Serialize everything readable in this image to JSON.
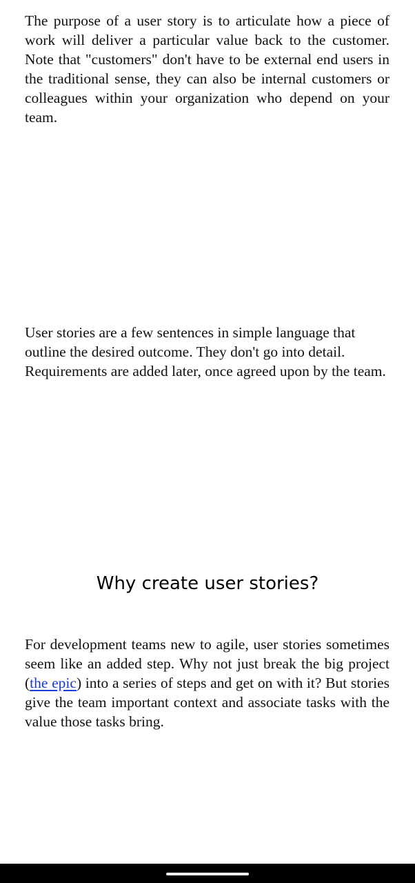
{
  "paragraphs": {
    "purpose": "The purpose of a user story is to articulate how a piece of work will deliver a particular value back to the customer. Note that \"customers\" don't have to be external end users in the traditional sense, they can also be internal customers or colleagues within your organization who depend on your team.",
    "definition": "User stories are a few sentences in simple language that outline the desired outcome. They don't go into detail. Requirements are added later, once agreed upon by the team."
  },
  "section": {
    "heading": "Why create user stories?",
    "body_before_link": "For development teams new to agile, user stories sometimes seem like an added step. Why not just break the big project (",
    "link_text": "the epic",
    "body_after_link": ") into a series of steps and get on with it? But stories give the team important context and associate tasks with the value those tasks bring."
  }
}
